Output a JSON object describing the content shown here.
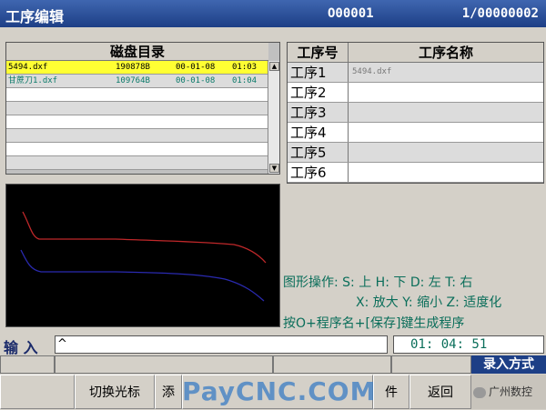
{
  "titlebar": {
    "title": "工序编辑",
    "program_no": "O00001",
    "count": "1/00000002"
  },
  "directory": {
    "heading": "磁盘目录",
    "rows": [
      {
        "name": "5494.dxf",
        "size": "190878B",
        "date": "00-01-08",
        "time": "01:03"
      },
      {
        "name": "甘蔗刀1.dxf",
        "size": "109764B",
        "date": "00-01-08",
        "time": "01:04"
      },
      {
        "name": "",
        "size": "",
        "date": "",
        "time": ""
      },
      {
        "name": "",
        "size": "",
        "date": "",
        "time": ""
      },
      {
        "name": "",
        "size": "",
        "date": "",
        "time": ""
      },
      {
        "name": "",
        "size": "",
        "date": "",
        "time": ""
      },
      {
        "name": "",
        "size": "",
        "date": "",
        "time": ""
      },
      {
        "name": "",
        "size": "",
        "date": "",
        "time": ""
      }
    ]
  },
  "process_table": {
    "header_no": "工序号",
    "header_name": "工序名称",
    "rows": [
      {
        "no": "工序1",
        "name": "5494.dxf"
      },
      {
        "no": "工序2",
        "name": ""
      },
      {
        "no": "工序3",
        "name": ""
      },
      {
        "no": "工序4",
        "name": ""
      },
      {
        "no": "工序5",
        "name": ""
      },
      {
        "no": "工序6",
        "name": ""
      }
    ]
  },
  "hints": {
    "line1": "图形操作: S: 上  H: 下  D: 左  T: 右",
    "line2": "X: 放大  Y: 缩小  Z: 适度化",
    "line3": "按O+程序名+[保存]键生成程序"
  },
  "input": {
    "label": "输 入",
    "value": "^",
    "clock": "01: 04: 51"
  },
  "mode_label": "录入方式",
  "softkeys": {
    "switch_cursor": "切换光标",
    "add": "添",
    "file_suffix": "件",
    "back": "返回"
  },
  "watermark": "PayCNC.COM",
  "wechat": "广州数控",
  "colors": {
    "titlebar": "#1d3f86",
    "selected_row": "#ffff33",
    "hint_text": "#0a6e5a",
    "curve_red": "#c0282a",
    "curve_blue": "#2a2ab0"
  }
}
